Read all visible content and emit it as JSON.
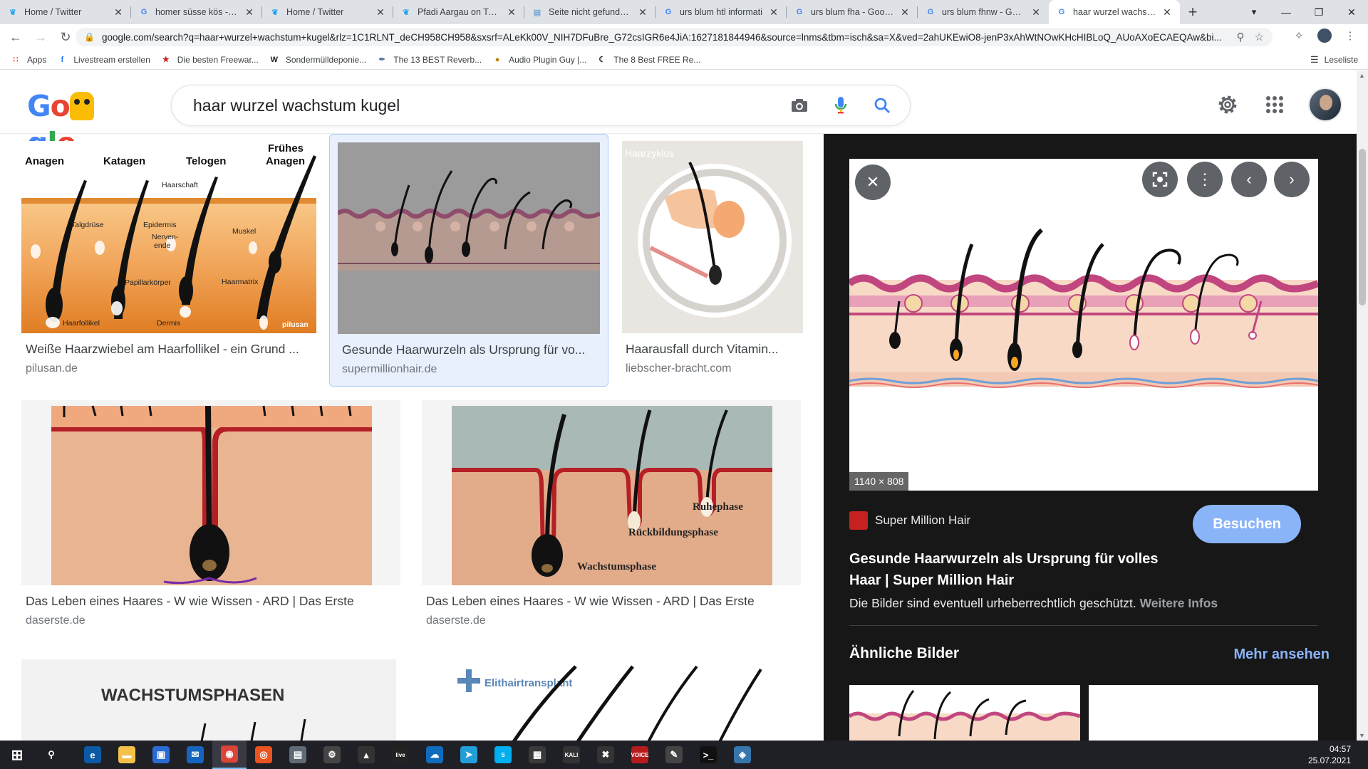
{
  "browser": {
    "tabs": [
      {
        "title": "Home / Twitter",
        "favicon": "twitter-icon",
        "color": "#1da1f2"
      },
      {
        "title": "homer süsse kös - Goo",
        "favicon": "google-icon",
        "color": "#4285f4"
      },
      {
        "title": "Home / Twitter",
        "favicon": "twitter-icon",
        "color": "#1da1f2"
      },
      {
        "title": "Pfadi Aargau on Twitte",
        "favicon": "twitter-icon",
        "color": "#1da1f2"
      },
      {
        "title": "Seite nicht gefunden –",
        "favicon": "page-icon",
        "color": "#7aa7d8"
      },
      {
        "title": "urs blum htl informati",
        "favicon": "google-icon",
        "color": "#4285f4"
      },
      {
        "title": "urs blum fha - Google",
        "favicon": "google-icon",
        "color": "#4285f4"
      },
      {
        "title": "urs blum fhnw - Goog",
        "favicon": "google-icon",
        "color": "#4285f4"
      },
      {
        "title": "haar wurzel wachstum",
        "favicon": "google-icon",
        "color": "#4285f4"
      }
    ],
    "url": "google.com/search?q=haar+wurzel+wachstum+kugel&rlz=1C1RLNT_deCH958CH958&sxsrf=ALeKk00V_NIH7DFuBre_G72csIGR6e4JiA:1627181844946&source=lnms&tbm=isch&sa=X&ved=2ahUKEwiO8-jenP3xAhWtNOwKHcHIBLoQ_AUoAXoECAEQAw&bi...",
    "bookmarks": [
      {
        "label": "Apps",
        "icon": "apps-grid-icon"
      },
      {
        "label": "Livestream erstellen",
        "icon": "facebook-icon"
      },
      {
        "label": "Die besten Freewar...",
        "icon": "star-icon"
      },
      {
        "label": "Sondermülldeponie...",
        "icon": "w-icon"
      },
      {
        "label": "The 13 BEST Reverb...",
        "icon": "feather-icon"
      },
      {
        "label": "Audio Plugin Guy |...",
        "icon": "plugin-icon"
      },
      {
        "label": "The 8 Best FREE Re...",
        "icon": "moon-icon"
      }
    ],
    "reading_list": "Leseliste"
  },
  "search": {
    "query": "haar wurzel wachstum kugel"
  },
  "results": [
    {
      "title": "Weiße Haarzwiebel am Haarfollikel - ein Grund ...",
      "source": "pilusan.de"
    },
    {
      "title": "Gesunde Haarwurzeln als Ursprung für vo...",
      "source": "supermillionhair.de"
    },
    {
      "title": "Haarausfall durch Vitamin...",
      "source": "liebscher-bracht.com"
    },
    {
      "title": "Das Leben eines Haares - W wie Wissen - ARD | Das Erste",
      "source": "daserste.de"
    },
    {
      "title": "Das Leben eines Haares - W wie Wissen - ARD | Das Erste",
      "source": "daserste.de"
    }
  ],
  "thumb_text": {
    "phases": [
      "Anagen",
      "Katagen",
      "Telogen",
      "Frühes",
      "Anagen"
    ],
    "labels": [
      "Haarschaft",
      "Talgdrüse",
      "Epidermis",
      "Nerven-",
      "ende",
      "Muskel",
      "Papillarkörper",
      "Haarmatrix",
      "Haarfollikel",
      "Dermis",
      "pilusan"
    ],
    "zyklus": "Haarzyklus",
    "w_phases": [
      "Ruhephase",
      "Rückbildungsphase",
      "Wachstumsphase"
    ],
    "wachstumsphasen": "WACHSTUMSPHASEN",
    "elithair": "Elithairtransplant"
  },
  "preview": {
    "dims": "1140 × 808",
    "source_name": "Super Million Hair",
    "visit_label": "Besuchen",
    "title": "Gesunde Haarwurzeln als Ursprung für volles Haar | Super Million Hair",
    "note": "Die Bilder sind eventuell urheberrechtlich geschützt.",
    "note_link": "Weitere Infos",
    "similar_heading": "Ähnliche Bilder",
    "more_label": "Mehr ansehen"
  },
  "taskbar": {
    "time": "04:57",
    "date": "25.07.2021",
    "apps": [
      {
        "icon": "windows-icon",
        "label": ""
      },
      {
        "icon": "search-icon",
        "label": ""
      },
      {
        "icon": "edge-icon",
        "label": ""
      },
      {
        "icon": "explorer-icon",
        "label": ""
      },
      {
        "icon": "store-icon",
        "label": ""
      },
      {
        "icon": "mail-icon",
        "label": ""
      },
      {
        "icon": "chrome-icon",
        "label": ""
      },
      {
        "icon": "ubuntu-icon",
        "label": ""
      },
      {
        "icon": "notepad-icon",
        "label": ""
      },
      {
        "icon": "gear-app-icon",
        "label": ""
      },
      {
        "icon": "inkscape-icon",
        "label": ""
      },
      {
        "icon": "live-icon",
        "label": "live"
      },
      {
        "icon": "onedrive-icon",
        "label": ""
      },
      {
        "icon": "telegram-icon",
        "label": ""
      },
      {
        "icon": "skype-icon",
        "label": "S"
      },
      {
        "icon": "calc-icon",
        "label": ""
      },
      {
        "icon": "kali-icon",
        "label": "KALI"
      },
      {
        "icon": "xmind-icon",
        "label": ""
      },
      {
        "icon": "voicemeeter-icon",
        "label": "VOICE"
      },
      {
        "icon": "editor-icon",
        "label": ""
      },
      {
        "icon": "terminal-icon",
        "label": ""
      },
      {
        "icon": "python-icon",
        "label": ""
      }
    ]
  }
}
